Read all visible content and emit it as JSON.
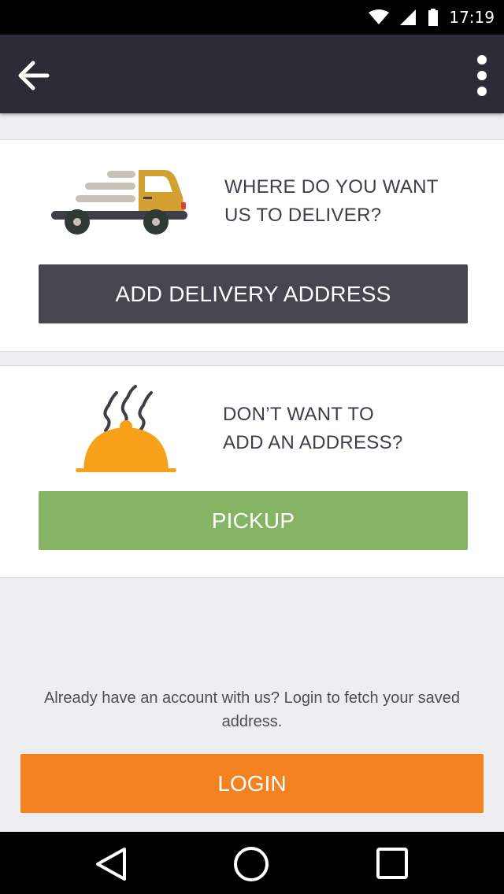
{
  "status_bar": {
    "time": "17:19",
    "icons": [
      "wifi-icon",
      "cell-signal-icon",
      "battery-icon"
    ]
  },
  "app_bar": {
    "back_icon": "arrow-left-icon",
    "menu_icon": "more-vert-icon"
  },
  "delivery": {
    "prompt_line1": "WHERE DO YOU WANT",
    "prompt_line2": "US TO DELIVER?",
    "button_label": "ADD DELIVERY ADDRESS",
    "illustration": "delivery-truck-icon"
  },
  "pickup": {
    "prompt_line1": "DON’T WANT TO",
    "prompt_line2": "ADD AN ADDRESS?",
    "button_label": "PICKUP",
    "illustration": "food-cloche-icon"
  },
  "login": {
    "note": "Already have an account with us? Login to fetch your saved address.",
    "button_label": "LOGIN"
  },
  "nav_bar": {
    "icons": [
      "nav-back-icon",
      "nav-home-icon",
      "nav-recents-icon"
    ]
  },
  "colors": {
    "app_bar": "#2b2c35",
    "delivery_button": "#454650",
    "pickup_button": "#84b464",
    "login_button": "#f58220",
    "truck_cab": "#d3a032",
    "cloche": "#f7a11a"
  }
}
